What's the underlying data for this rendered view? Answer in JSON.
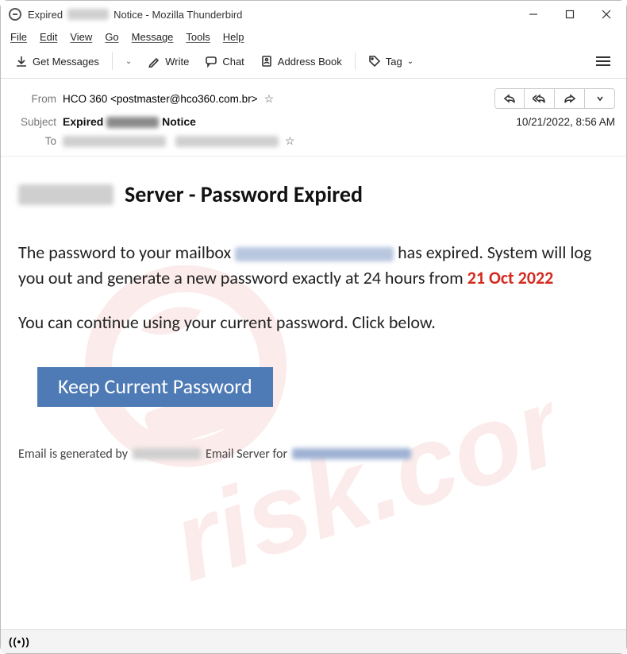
{
  "window": {
    "title_prefix": "Expired",
    "title_suffix": "Notice - Mozilla Thunderbird"
  },
  "menu": {
    "file": "File",
    "edit": "Edit",
    "view": "View",
    "go": "Go",
    "message": "Message",
    "tools": "Tools",
    "help": "Help"
  },
  "toolbar": {
    "get_messages": "Get Messages",
    "write": "Write",
    "chat": "Chat",
    "address_book": "Address Book",
    "tag": "Tag"
  },
  "headers": {
    "from_label": "From",
    "from_value": "HCO 360 <postmaster@hco360.com.br>",
    "subject_label": "Subject",
    "subject_prefix": "Expired",
    "subject_suffix": "Notice",
    "to_label": "To",
    "datetime": "10/21/2022, 8:56 AM"
  },
  "body": {
    "heading_suffix": "Server - Password Expired",
    "p1_pre": "The password to your  mailbox",
    "p1_post": "has expired. System will log you out and generate a new password exactly at 24 hours from",
    "date": "21 Oct 2022",
    "p2": "You can continue using your current password. Click below.",
    "cta": "Keep Current Password",
    "footer_pre": "Email is generated by",
    "footer_mid": "Email Server for"
  },
  "statusbar": {
    "sync_icon": "((•))"
  }
}
